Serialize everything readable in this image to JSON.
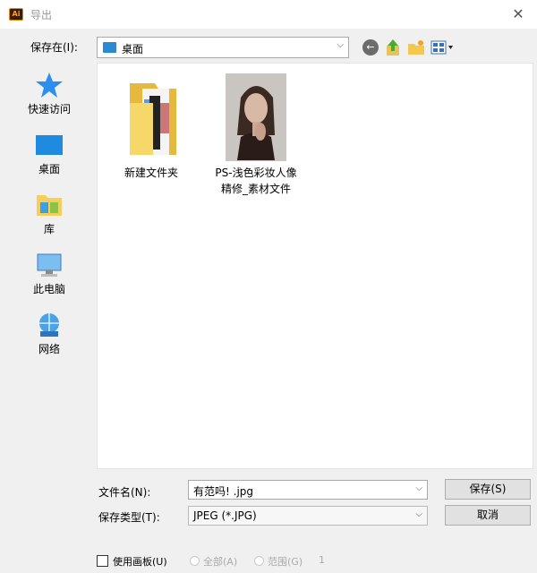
{
  "window": {
    "title": "导出",
    "app_icon_text": "Ai",
    "close_glyph": "✕"
  },
  "savein": {
    "label": "保存在(I):",
    "value": "桌面"
  },
  "places": [
    {
      "label": "快速访问",
      "icon": "star-icon"
    },
    {
      "label": "桌面",
      "icon": "desktop-icon"
    },
    {
      "label": "库",
      "icon": "library-icon"
    },
    {
      "label": "此电脑",
      "icon": "computer-icon"
    },
    {
      "label": "网络",
      "icon": "network-icon"
    }
  ],
  "files": [
    {
      "name": "新建文件夹",
      "icon": "folder-icon"
    },
    {
      "name_line1": "PS-浅色彩妆人像",
      "name_line2": "精修_素材文件",
      "icon": "portrait-thumbnail"
    }
  ],
  "form": {
    "filename_label": "文件名(N):",
    "filename_value": "有范吗! .jpg",
    "filetype_label": "保存类型(T):",
    "filetype_value": "JPEG (*.JPG)",
    "save_button": "保存(S)",
    "cancel_button": "取消"
  },
  "artboards": {
    "use_label": "使用画板(U)",
    "all_label": "全部(A)",
    "range_label": "范围(G)",
    "range_value": "1",
    "checked": false
  },
  "colors": {
    "folder_blue": "#2a8ad4",
    "folder_yellow": "#f5cf5a",
    "star_blue": "#2b8ff0"
  }
}
